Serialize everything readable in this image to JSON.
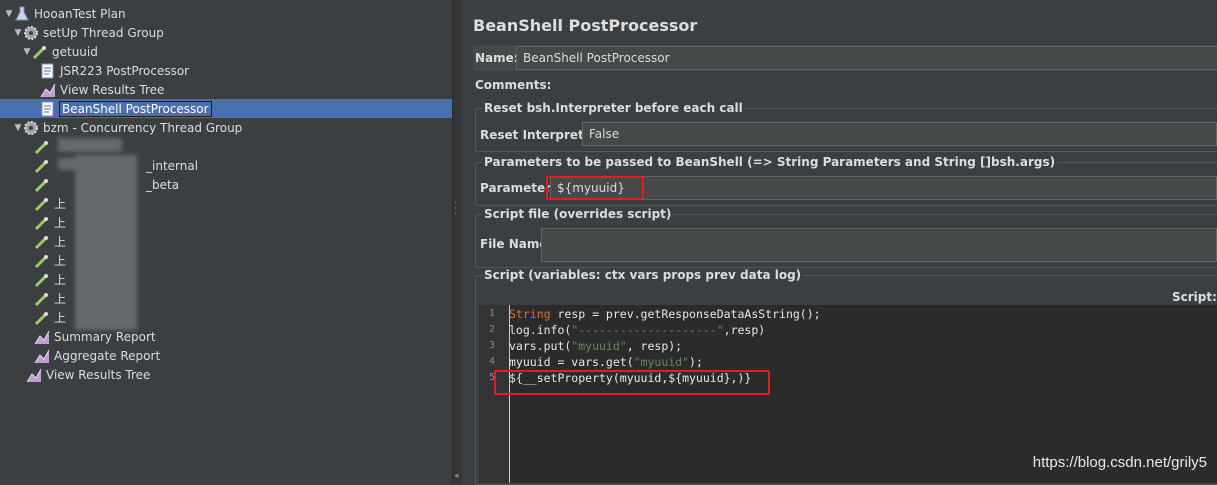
{
  "tree": {
    "items": [
      {
        "label": "HooanTest Plan",
        "icon": "flask-icon"
      },
      {
        "label": "setUp Thread Group",
        "icon": "gear-icon"
      },
      {
        "label": "getuuid",
        "icon": "sampler-icon"
      },
      {
        "label": "JSR223 PostProcessor",
        "icon": "script-icon"
      },
      {
        "label": "View Results Tree",
        "icon": "chart-icon"
      },
      {
        "label": "BeanShell PostProcessor",
        "icon": "script-icon"
      },
      {
        "label": "bzm - Concurrency Thread Group",
        "icon": "gear-icon"
      },
      {
        "label": "",
        "icon": "sampler-icon"
      },
      {
        "label": "_internal",
        "icon": "sampler-icon"
      },
      {
        "label": "_beta",
        "icon": "sampler-icon"
      },
      {
        "label": "上",
        "icon": "sampler-icon"
      },
      {
        "label": "上",
        "icon": "sampler-icon"
      },
      {
        "label": "上",
        "icon": "sampler-icon"
      },
      {
        "label": "上",
        "icon": "sampler-icon"
      },
      {
        "label": "上",
        "icon": "sampler-icon"
      },
      {
        "label": "上",
        "icon": "sampler-icon"
      },
      {
        "label": "上",
        "icon": "sampler-icon"
      },
      {
        "label": "Summary Report",
        "icon": "chart-icon"
      },
      {
        "label": "Aggregate Report",
        "icon": "chart-icon"
      },
      {
        "label": "View Results Tree",
        "icon": "chart-icon"
      }
    ]
  },
  "panel": {
    "title": "BeanShell PostProcessor",
    "name_label": "Name:",
    "name_value": "BeanShell PostProcessor",
    "comments_label": "Comments:",
    "reset_legend": "Reset bsh.Interpreter before each call",
    "reset_label": "Reset Interpreter:",
    "reset_value": "False",
    "params_legend": "Parameters to be passed to BeanShell (=> String Parameters and String []bsh.args)",
    "params_label": "Parameters:",
    "params_value": "${myuuid}",
    "script_file_legend": "Script file (overrides script)",
    "file_name_label": "File Name:",
    "file_name_value": "",
    "script_legend": "Script (variables: ctx vars props prev data log)",
    "script_label": "Script:",
    "code_lines": [
      {
        "n": "1",
        "text": "String resp = prev.getResponseDataAsString();"
      },
      {
        "n": "2",
        "text": "log.info(\"--------------------\",resp)"
      },
      {
        "n": "3",
        "text": "vars.put(\"myuuid\", resp);"
      },
      {
        "n": "4",
        "text": "myuuid = vars.get(\"myuuid\");"
      },
      {
        "n": "5",
        "text": "${__setProperty(myuuid,${myuuid},)}"
      }
    ]
  },
  "watermark": "https://blog.csdn.net/grily5",
  "colors": {
    "selection": "#4b6eaf",
    "highlight_box": "#e0201d"
  }
}
